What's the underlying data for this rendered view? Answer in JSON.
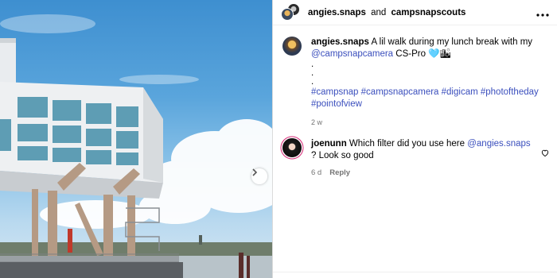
{
  "post": {
    "header": {
      "author": "angies.snaps",
      "connector": "and",
      "collaborator": "campsnapscouts"
    },
    "caption": {
      "username": "angies.snaps",
      "text": "A lil walk during my lunch break with my",
      "mention": "@campsnapcamera",
      "text_after": "CS-Pro 🩵🏙",
      "dots": [
        ".",
        ".",
        "."
      ],
      "hashtags": "#campsnap #campsnapcamera #digicam #photoftheday #pointofview",
      "time": "2 w"
    },
    "comments": [
      {
        "username": "joenunn",
        "text": "Which filter did you use here",
        "mention": "@angies.snaps",
        "text_after": "? Look so good",
        "time": "6 d",
        "reply_label": "Reply"
      }
    ]
  },
  "icons": {
    "more": "more-options-icon",
    "next": "chevron-right-icon",
    "like": "heart-icon"
  },
  "colors": {
    "link": "#3b4fbd",
    "meta": "#737373",
    "border": "#dbdbdb"
  }
}
